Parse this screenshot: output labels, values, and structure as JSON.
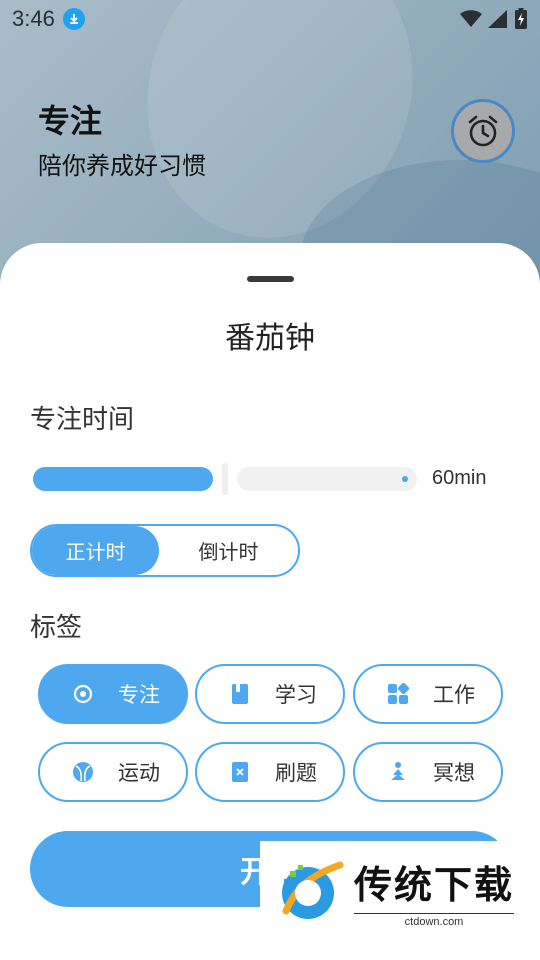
{
  "status": {
    "time": "3:46"
  },
  "header": {
    "title": "专注",
    "subtitle": "陪你养成好习惯"
  },
  "sheet": {
    "title": "番茄钟",
    "focus_time_label": "专注时间",
    "slider": {
      "value_text": "60min",
      "level": 0.5
    },
    "timer_modes": [
      {
        "label": "正计时",
        "selected": true
      },
      {
        "label": "倒计时",
        "selected": false
      }
    ],
    "tags_label": "标签",
    "tags": [
      {
        "label": "专注",
        "icon": "eye-icon",
        "selected": true
      },
      {
        "label": "学习",
        "icon": "book-icon",
        "selected": false
      },
      {
        "label": "工作",
        "icon": "apps-icon",
        "selected": false
      },
      {
        "label": "运动",
        "icon": "ball-icon",
        "selected": false
      },
      {
        "label": "刷题",
        "icon": "note-icon",
        "selected": false
      },
      {
        "label": "冥想",
        "icon": "meditation-icon",
        "selected": false
      }
    ],
    "start_button": "开"
  },
  "watermark": {
    "name": "传统下载",
    "url": "ctdown.com"
  },
  "colors": {
    "accent": "#4da8f0",
    "accent_border": "#4a88c8"
  }
}
